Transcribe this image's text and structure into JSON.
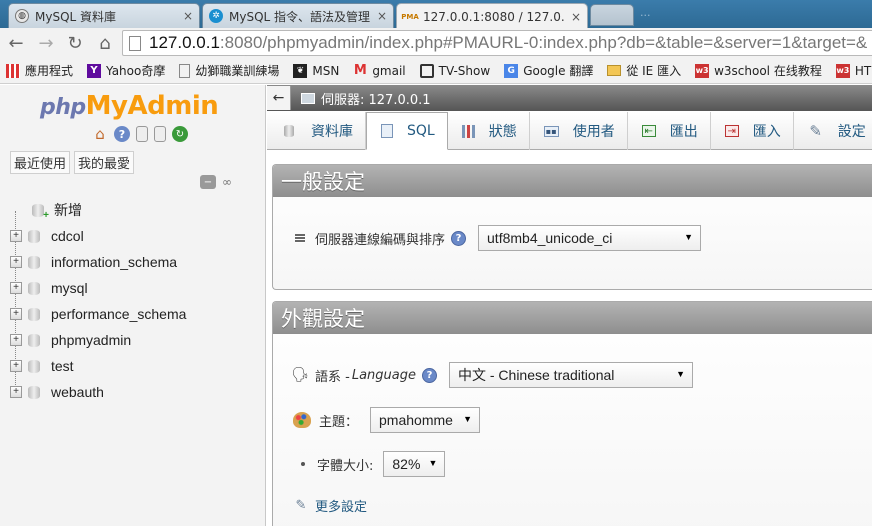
{
  "browser": {
    "tabs": [
      {
        "title": "MySQL 資料庫",
        "icon": "globe-icon",
        "close": "×"
      },
      {
        "title": "MySQL 指令、語法及管理",
        "icon": "gear-icon",
        "close": "×"
      },
      {
        "title": "127.0.0.1:8080 / 127.0.0.",
        "icon": "pma-icon",
        "icon_text": "PMA",
        "close": "×"
      }
    ],
    "blurred_tab_text": "...",
    "url": {
      "host": "127.0.0.1",
      "rest": ":8080/phpmyadmin/index.php#PMAURL-0:index.php?db=&table=&server=1&target=&"
    },
    "bookmarks": [
      {
        "label": "應用程式",
        "icon": "apps-grid-icon"
      },
      {
        "label": "Yahoo奇摩",
        "icon": "yahoo-icon",
        "icon_text": "Y"
      },
      {
        "label": "幼獅職業訓練場",
        "icon": "page-icon"
      },
      {
        "label": "MSN",
        "icon": "msn-icon"
      },
      {
        "label": "gmail",
        "icon": "gmail-icon",
        "icon_text": "M"
      },
      {
        "label": "TV-Show",
        "icon": "tv-icon"
      },
      {
        "label": "Google 翻譯",
        "icon": "translate-icon"
      },
      {
        "label": "從 IE 匯入",
        "icon": "folder-icon"
      },
      {
        "label": "w3school 在线教程",
        "icon": "w3-icon",
        "icon_text": "w3"
      },
      {
        "label": "HT",
        "icon": "w3-icon",
        "icon_text": "w3"
      }
    ]
  },
  "sidebar": {
    "logo_php": "php",
    "logo_myadmin": "MyAdmin",
    "recent_label": "最近使用",
    "favorites_label": "我的最愛",
    "new_label": "新增",
    "databases": [
      "cdcol",
      "information_schema",
      "mysql",
      "performance_schema",
      "phpmyadmin",
      "test",
      "webauth"
    ]
  },
  "main": {
    "breadcrumb": "伺服器: 127.0.0.1",
    "tabs": [
      {
        "label": "資料庫",
        "icon": "database-icon"
      },
      {
        "label": "SQL",
        "icon": "sql-icon"
      },
      {
        "label": "狀態",
        "icon": "status-icon"
      },
      {
        "label": "使用者",
        "icon": "users-icon"
      },
      {
        "label": "匯出",
        "icon": "export-icon"
      },
      {
        "label": "匯入",
        "icon": "import-icon"
      },
      {
        "label": "設定",
        "icon": "settings-icon"
      }
    ],
    "general_settings": {
      "title": "一般設定",
      "collation_label": "伺服器連線編碼與排序",
      "collation_value": "utf8mb4_unicode_ci"
    },
    "appearance_settings": {
      "title": "外觀設定",
      "language_label": "語系 - ",
      "language_label_en": "Language",
      "language_value": "中文 - Chinese traditional",
      "theme_label": "主題：",
      "theme_value": "pmahomme",
      "font_size_label": "字體大小:",
      "font_size_value": "82%",
      "more_settings": "更多設定"
    }
  },
  "colors": {
    "logo_php": "#6c78af",
    "logo_myadmin": "#f89c0e",
    "link": "#235a81",
    "tabstrip": "#2f6d98"
  }
}
